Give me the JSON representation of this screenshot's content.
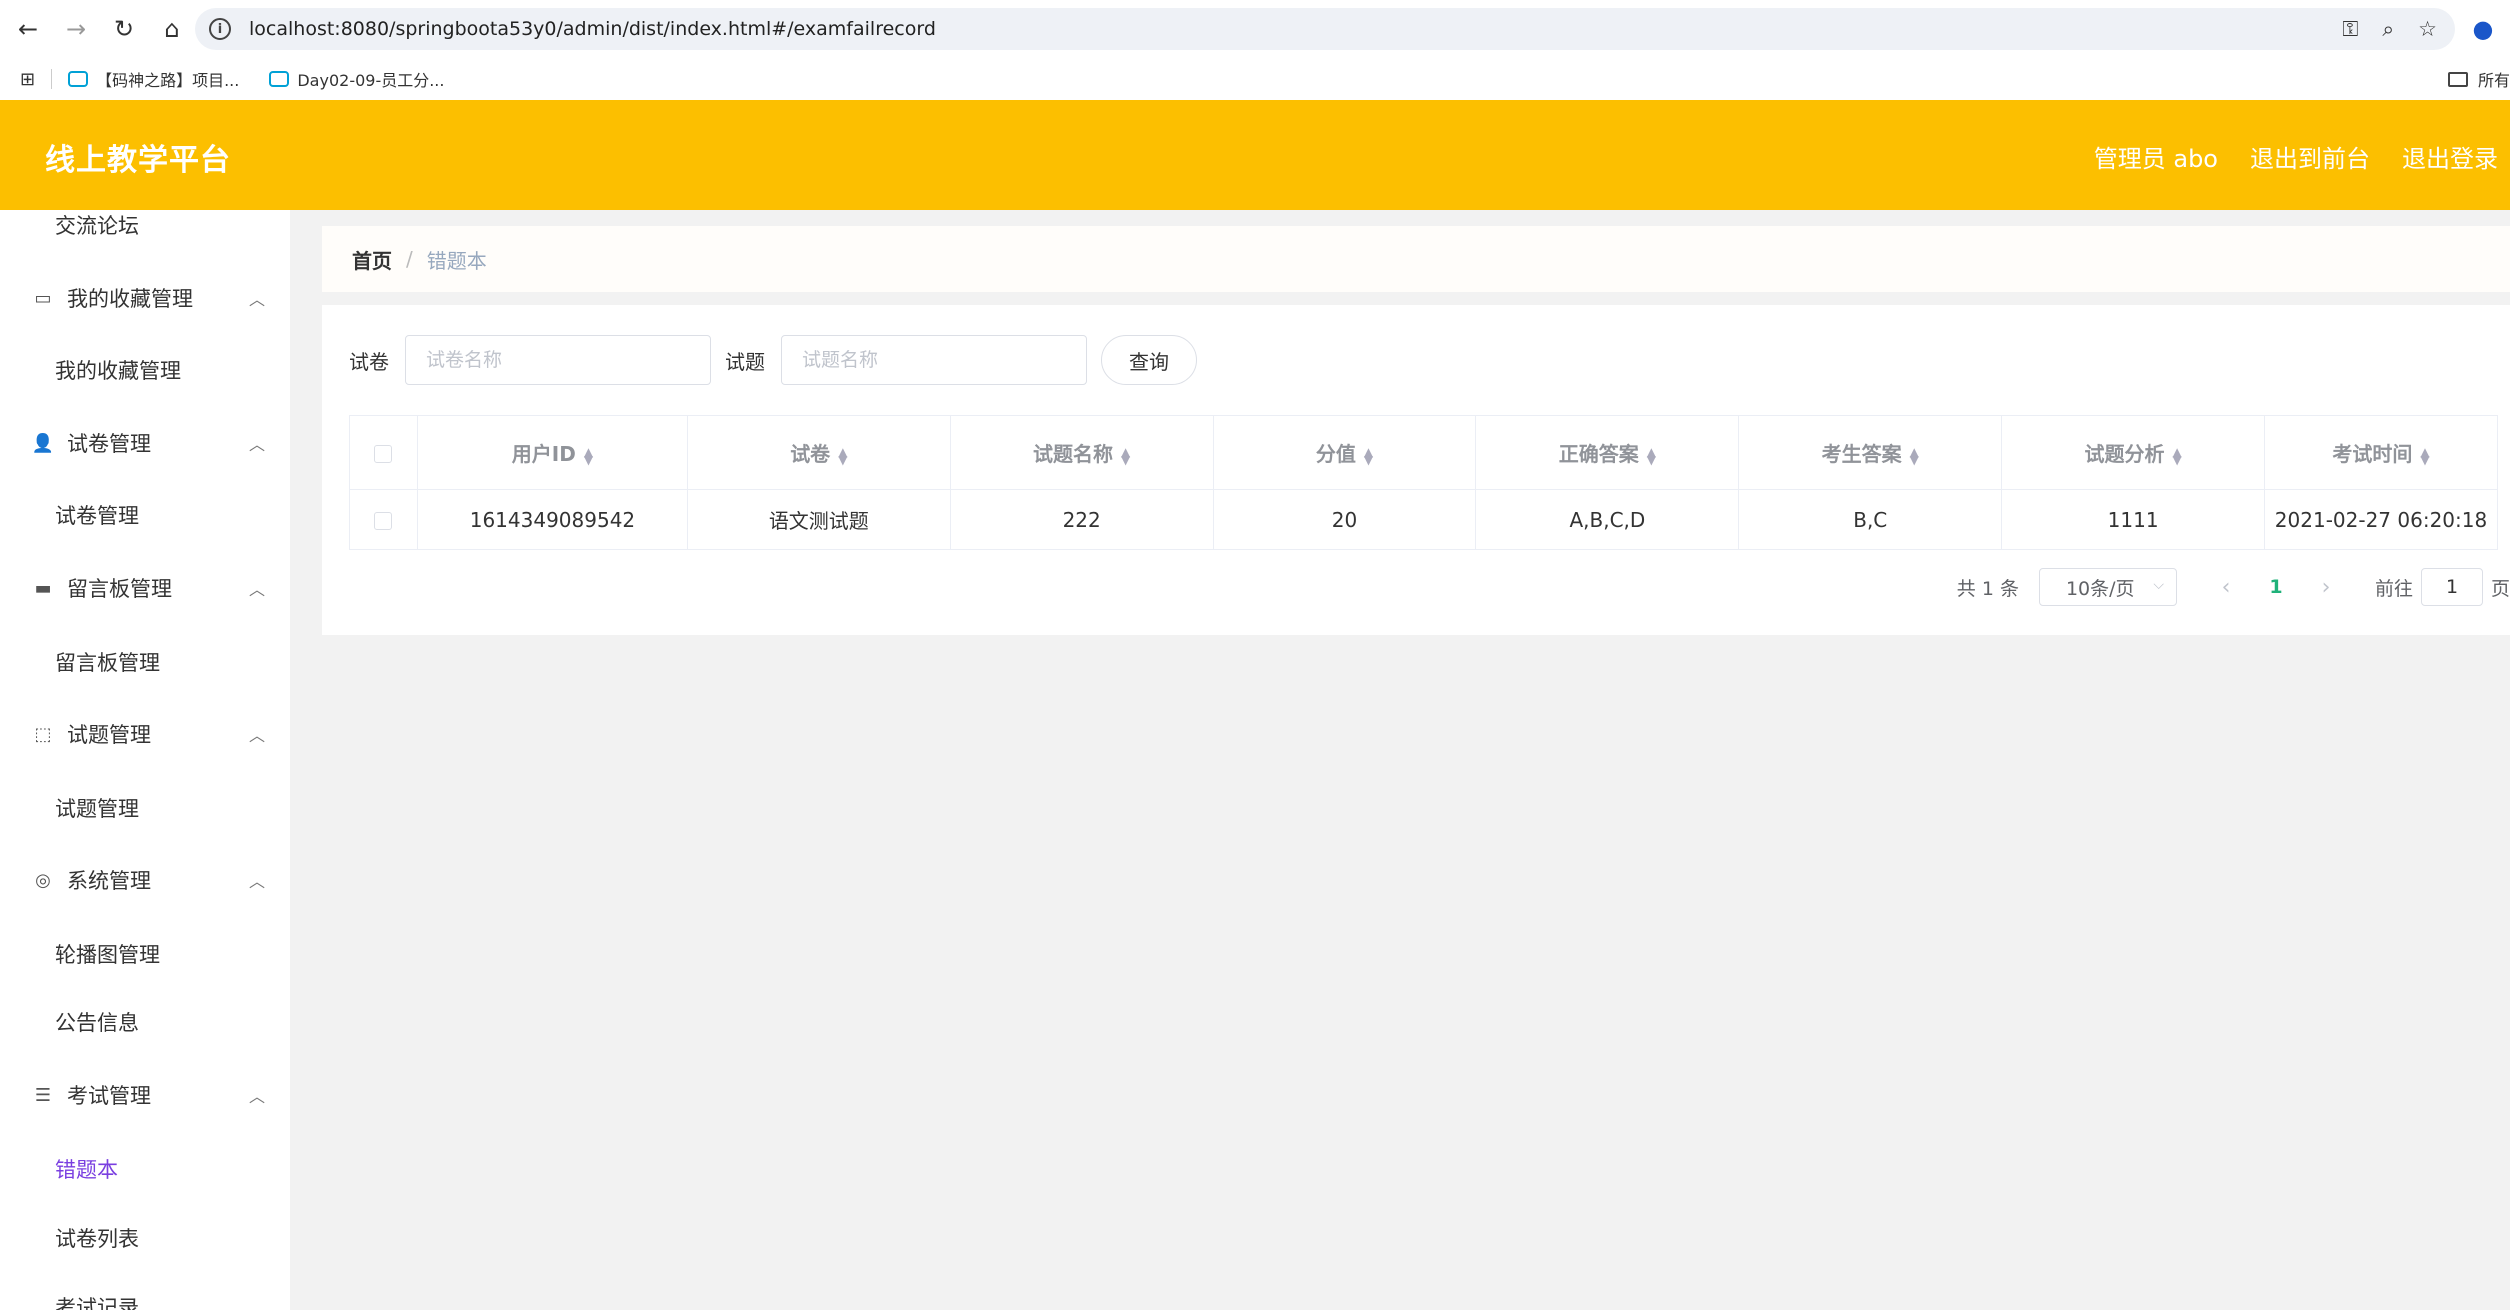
{
  "browser": {
    "url": "localhost:8080/springboota53y0/admin/dist/index.html#/examfailrecord",
    "bookmarks": [
      "【码神之路】项目...",
      "Day02-09-员工分..."
    ],
    "bookmarks_right": "所有"
  },
  "header": {
    "brand": "线上教学平台",
    "links": [
      "管理员 abo",
      "退出到前台",
      "退出登录"
    ]
  },
  "sidebar": {
    "items": [
      {
        "type": "sub",
        "label": "交流论坛"
      },
      {
        "type": "group",
        "label": "我的收藏管理",
        "icon": "collect-icon"
      },
      {
        "type": "sub",
        "label": "我的收藏管理"
      },
      {
        "type": "group",
        "label": "试卷管理",
        "icon": "user-icon"
      },
      {
        "type": "sub",
        "label": "试卷管理"
      },
      {
        "type": "group",
        "label": "留言板管理",
        "icon": "monitor-icon"
      },
      {
        "type": "sub",
        "label": "留言板管理"
      },
      {
        "type": "group",
        "label": "试题管理",
        "icon": "chart-icon"
      },
      {
        "type": "sub",
        "label": "试题管理"
      },
      {
        "type": "group",
        "label": "系统管理",
        "icon": "lifebuoy-icon"
      },
      {
        "type": "sub",
        "label": "轮播图管理"
      },
      {
        "type": "sub",
        "label": "公告信息"
      },
      {
        "type": "group",
        "label": "考试管理",
        "icon": "list-icon"
      },
      {
        "type": "sub",
        "label": "错题本",
        "active": true
      },
      {
        "type": "sub",
        "label": "试卷列表"
      },
      {
        "type": "sub",
        "label": "考试记录"
      }
    ]
  },
  "breadcrumb": {
    "home": "首页",
    "separator": "/",
    "current": "错题本"
  },
  "search": {
    "paper_label": "试卷",
    "paper_placeholder": "试卷名称",
    "question_label": "试题",
    "question_placeholder": "试题名称",
    "button": "查询"
  },
  "table": {
    "columns": [
      "用户ID",
      "试卷",
      "试题名称",
      "分值",
      "正确答案",
      "考生答案",
      "试题分析",
      "考试时间"
    ],
    "rows": [
      [
        "1614349089542",
        "语文测试题",
        "222",
        "20",
        "A,B,C,D",
        "B,C",
        "1111",
        "2021-02-27 06:20:18"
      ]
    ]
  },
  "pagination": {
    "total": "共 1 条",
    "page_size": "10条/页",
    "current_page": "1",
    "goto_label": "前往",
    "goto_value": "1",
    "page_suffix": "页"
  },
  "colors": {
    "header": "#fcbf00",
    "active_menu": "#7a3fe0",
    "active_page": "#20b27a"
  }
}
